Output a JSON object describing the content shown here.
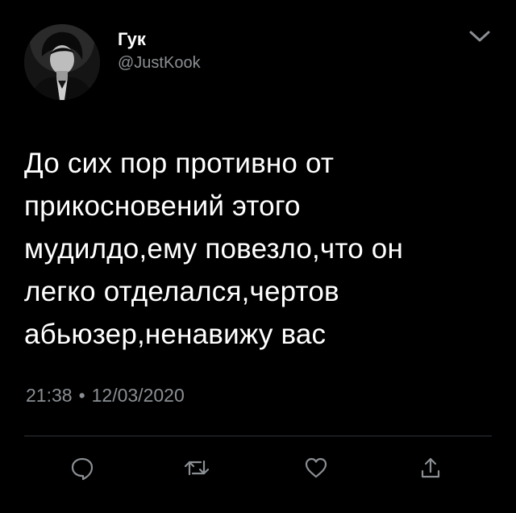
{
  "user": {
    "display_name": "Гук",
    "handle": "@JustKook"
  },
  "tweet": {
    "text": "До сих пор противно от\nприкосновений этого\nмудилдо,ему повезло,что он\nлегко отделался,чертов\nабьюзер,ненавижу вас",
    "time": "21:38",
    "separator": "•",
    "date": "12/03/2020"
  },
  "icons": {
    "caret": "chevron-down-icon",
    "reply": "reply-icon",
    "retweet": "retweet-icon",
    "like": "heart-icon",
    "share": "share-icon"
  },
  "colors": {
    "background": "#000000",
    "text": "#ffffff",
    "secondary": "#8b8f93",
    "divider": "#2f3336"
  }
}
